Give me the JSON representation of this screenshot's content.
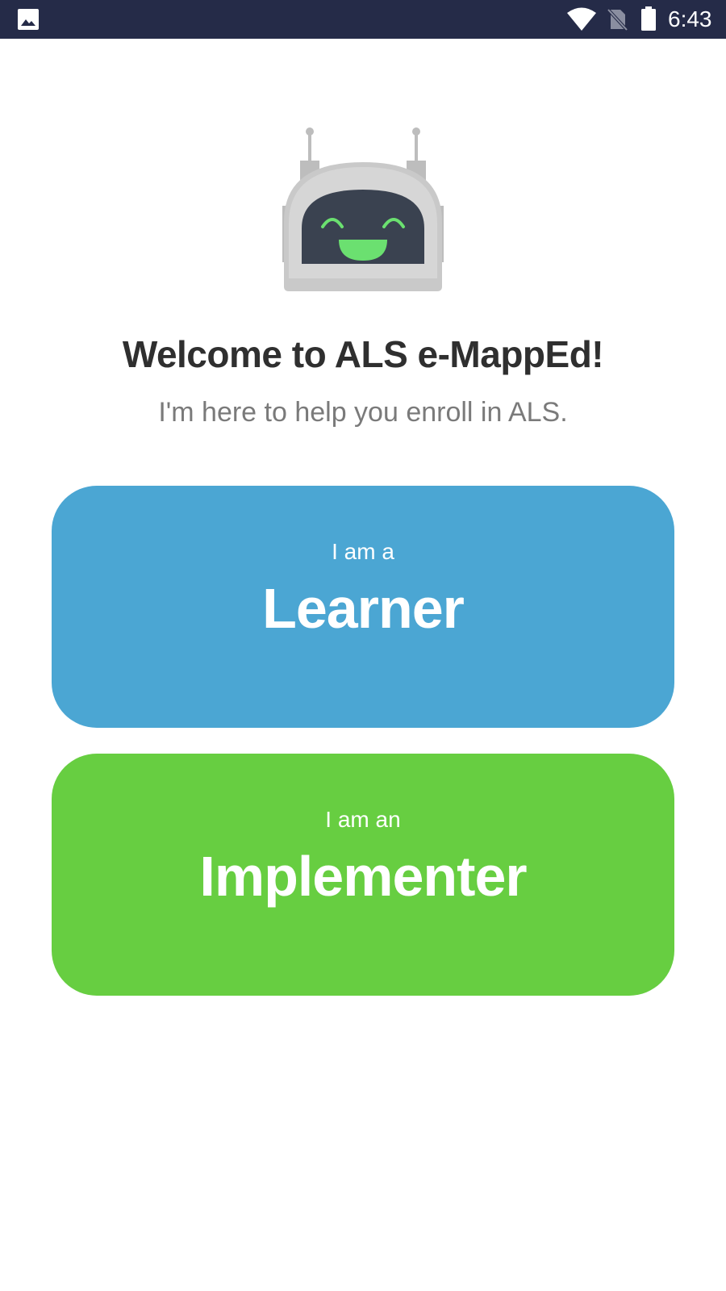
{
  "status_bar": {
    "time": "6:43",
    "background_color": "#252b48",
    "icons": [
      "gallery-icon",
      "wifi-icon",
      "no-sim-icon",
      "battery-icon"
    ]
  },
  "mascot": {
    "icon": "robot-mascot-icon",
    "face_color": "#6be070"
  },
  "welcome": {
    "title": "Welcome to ALS e-MappEd!",
    "subtitle": "I'm here to help you enroll in ALS."
  },
  "roles": [
    {
      "prefix": "I am a",
      "label": "Learner",
      "color": "#4ba6d3"
    },
    {
      "prefix": "I am an",
      "label": "Implementer",
      "color": "#67ce41"
    }
  ]
}
